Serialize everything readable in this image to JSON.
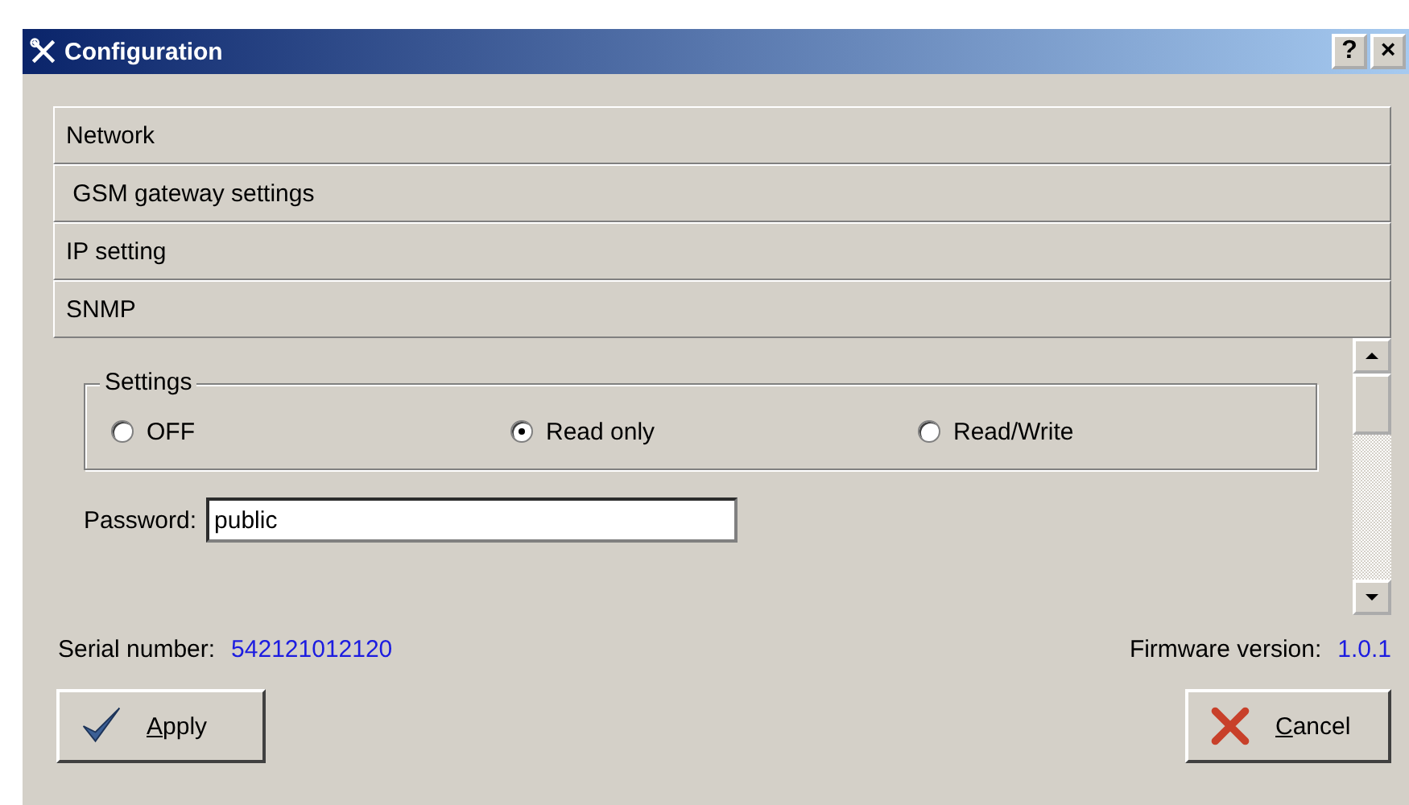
{
  "window": {
    "title": "Configuration",
    "buttons": [
      "?",
      "×"
    ]
  },
  "sections": [
    {
      "label": "Network"
    },
    {
      "label": " GSM gateway settings"
    },
    {
      "label": "IP setting"
    },
    {
      "label": "SNMP"
    }
  ],
  "settings": {
    "legend": "Settings",
    "options": [
      {
        "label": "OFF",
        "selected": false
      },
      {
        "label": "Read only",
        "selected": true
      },
      {
        "label": "Read/Write",
        "selected": false
      }
    ]
  },
  "password": {
    "label": "Password:",
    "value": "public"
  },
  "serial": {
    "label": "Serial number:",
    "value": "542121012120"
  },
  "firmware": {
    "label": "Firmware version:",
    "value": "1.0.1"
  },
  "actions": [
    {
      "kind": "apply",
      "label": "Apply"
    },
    {
      "kind": "cancel",
      "label": "Cancel"
    }
  ]
}
